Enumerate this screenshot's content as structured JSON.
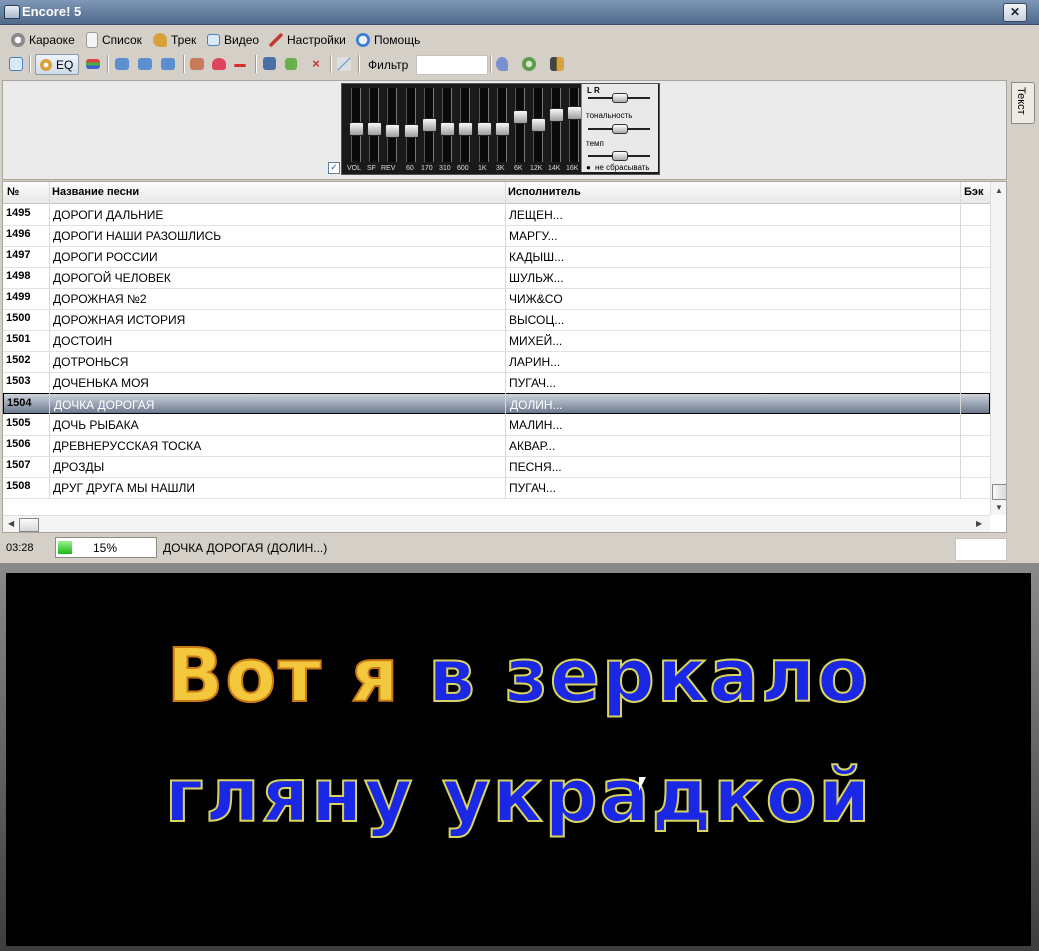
{
  "window": {
    "title": "Encore! 5",
    "close_symbol": "✕"
  },
  "menu": [
    {
      "label": "Караоке",
      "icon": "microphone-icon",
      "color": "#7a7a7a"
    },
    {
      "label": "Список",
      "icon": "document-icon",
      "color": "#e8e8e8"
    },
    {
      "label": "Трек",
      "icon": "music-note-icon",
      "color": "#d8a23a"
    },
    {
      "label": "Видео",
      "icon": "monitor-icon",
      "color": "#4a7fc1"
    },
    {
      "label": "Настройки",
      "icon": "wrench-icon",
      "color": "#c53a2e"
    },
    {
      "label": "Помощь",
      "icon": "help-icon",
      "color": "#3b7fd0"
    }
  ],
  "toolbar": {
    "eq_label": "EQ",
    "filter_label": "Фильтр",
    "filter_value": ""
  },
  "side_tab": {
    "label": "Текст"
  },
  "equalizer": {
    "enabled": true,
    "labels": [
      "VOL",
      "SF",
      "REV",
      "60",
      "170",
      "310",
      "600",
      "1K",
      "3K",
      "6K",
      "12K",
      "14K",
      "16K"
    ],
    "tone_labels": {
      "lr": "L  R",
      "tonality": "тональность",
      "tempo": "темп",
      "no_reset": "не сбрасывать"
    }
  },
  "song_list": {
    "columns": {
      "num": "№",
      "title": "Название песни",
      "artist": "Исполнитель",
      "back": "Бэк"
    },
    "rows": [
      {
        "num": "1495",
        "title": "ДОРОГИ ДАЛЬНИЕ",
        "artist": "ЛЕЩЕН..."
      },
      {
        "num": "1496",
        "title": "ДОРОГИ НАШИ РАЗОШЛИСЬ",
        "artist": "МАРГУ..."
      },
      {
        "num": "1497",
        "title": "ДОРОГИ РОССИИ",
        "artist": "КАДЫШ..."
      },
      {
        "num": "1498",
        "title": "ДОРОГОЙ ЧЕЛОВЕК",
        "artist": "ШУЛЬЖ..."
      },
      {
        "num": "1499",
        "title": "ДОРОЖНАЯ №2",
        "artist": "ЧИЖ&CO"
      },
      {
        "num": "1500",
        "title": "ДОРОЖНАЯ ИСТОРИЯ",
        "artist": "ВЫСОЦ..."
      },
      {
        "num": "1501",
        "title": "ДОСТОИН",
        "artist": "МИХЕЙ..."
      },
      {
        "num": "1502",
        "title": "ДОТРОНЬСЯ",
        "artist": "ЛАРИН..."
      },
      {
        "num": "1503",
        "title": "ДОЧЕНЬКА МОЯ",
        "artist": "ПУГАЧ..."
      },
      {
        "num": "1504",
        "title": "ДОЧКА ДОРОГАЯ",
        "artist": "ДОЛИН...",
        "selected": true
      },
      {
        "num": "1505",
        "title": "ДОЧЬ РЫБАКА",
        "artist": "МАЛИН..."
      },
      {
        "num": "1506",
        "title": "ДРЕВНЕРУССКАЯ ТОСКА",
        "artist": "АКВАР..."
      },
      {
        "num": "1507",
        "title": "ДРОЗДЫ",
        "artist": "ПЕСНЯ..."
      },
      {
        "num": "1508",
        "title": "ДРУГ ДРУГА МЫ НАШЛИ",
        "artist": "ПУГАЧ..."
      }
    ]
  },
  "status": {
    "time": "03:28",
    "progress_percent": 15,
    "progress_text": "15%",
    "now_playing": "ДОЧКА ДОРОГАЯ (ДОЛИН...)"
  },
  "lyrics": {
    "line1_sung": "Вот я",
    "line1_unsung": "в зеркало",
    "line2": "гляну украдкой",
    "sung_color": "#f3c83c",
    "unsung_color": "#1a28e6"
  }
}
